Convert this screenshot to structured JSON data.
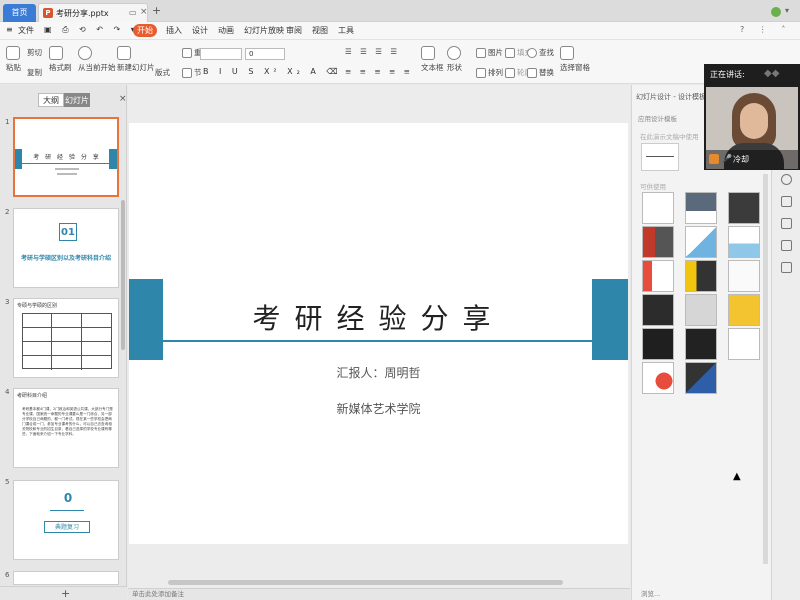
{
  "tabs": {
    "home": "首页",
    "file": "考研分享.pptx"
  },
  "menu": {
    "file": "文件",
    "start": "开始",
    "insert": "插入",
    "design": "设计",
    "animation": "动画",
    "slideshow": "幻灯片放映",
    "review": "审阅",
    "view": "视图",
    "tools": "工具"
  },
  "ribbon": {
    "paste": "粘贴",
    "cut": "剪切",
    "copy": "复制",
    "format_painter": "格式刷",
    "from_current": "从当前开始",
    "new_slide": "新建幻灯片",
    "layout": "版式",
    "section": "节",
    "reset": "重置",
    "font_size": "0",
    "textbox": "文本框",
    "shape": "形状",
    "arrange": "排列",
    "picture": "图片",
    "fill": "填充",
    "outline": "轮廓",
    "find": "查找",
    "replace": "替换",
    "select_pane": "选择窗格"
  },
  "left_panel": {
    "tab_outline": "大纲",
    "tab_slides": "幻灯片",
    "slides": [
      {
        "num": "1",
        "title": "考 研 经 验 分 享"
      },
      {
        "num": "2",
        "title": "考研与学硕区别以及考研科目介绍",
        "big": "01"
      },
      {
        "num": "3",
        "title": "专硕与学硕的区别"
      },
      {
        "num": "4",
        "title": "考研科目介绍",
        "body": "考研基本都4门课，2门政治和英语公共课，大部分专门是专业课，国家统一命题的专业课要么是一门综合，另一部分学校自己命题的，都一门考试。现在某一些学校会把两门课合成一门，参加专业课考的什么，可以自己去查询相关院校和专业的招生目录，看自己选择的学校专业课有哪些，下面就来介绍一下专业学科。"
      },
      {
        "num": "5",
        "title": "典题复习",
        "big": "0"
      },
      {
        "num": "6",
        "title": ""
      }
    ]
  },
  "slide": {
    "title": "考研经验分享",
    "reporter": "汇报人：周明哲",
    "school": "新媒体艺术学院"
  },
  "notes_placeholder": "单击此处添加备注",
  "right_panel": {
    "header": "幻灯片设计 - 设计模板",
    "applied": "应用设计模板",
    "in_use": "在此演示文稿中使用",
    "available": "可供使用",
    "footer": "浏览..."
  },
  "video": {
    "speaking_label": "正在讲话:",
    "name": "冷却"
  },
  "colors": {
    "accent_blue": "#2e86ab",
    "start_orange": "#e85d2f",
    "selected_border": "#e8743b"
  }
}
